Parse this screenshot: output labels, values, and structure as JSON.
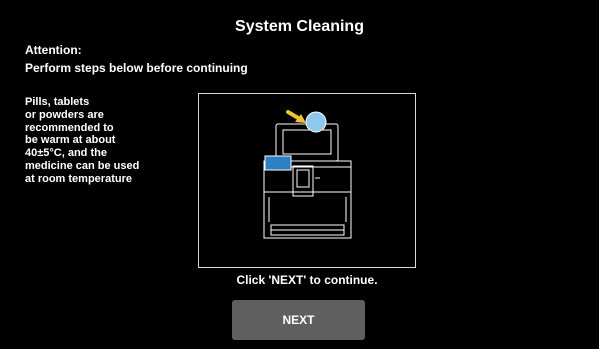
{
  "header": {
    "title": "System Cleaning"
  },
  "attention": {
    "heading": "Attention:",
    "message": "Perform steps below before continuing"
  },
  "note": {
    "lines": [
      "Pills, tablets",
      "or powders are",
      "recommended to",
      "be warm at about",
      "40±5°C, and the",
      "medicine can be used",
      "at room temperature"
    ]
  },
  "illustration": {
    "icons": [
      "device-icon",
      "arrow-icon",
      "highlight-circle-icon"
    ],
    "colors": {
      "highlight": "#8ec9ec",
      "arrow": "#f2c230",
      "tray": "#2c7fc3",
      "outline": "#ffffff"
    }
  },
  "instruction": {
    "text": "Click 'NEXT' to continue."
  },
  "footer": {
    "next_label": "NEXT"
  },
  "colors": {
    "background": "#000000",
    "text": "#ffffff",
    "button": "#5f5f5f"
  }
}
